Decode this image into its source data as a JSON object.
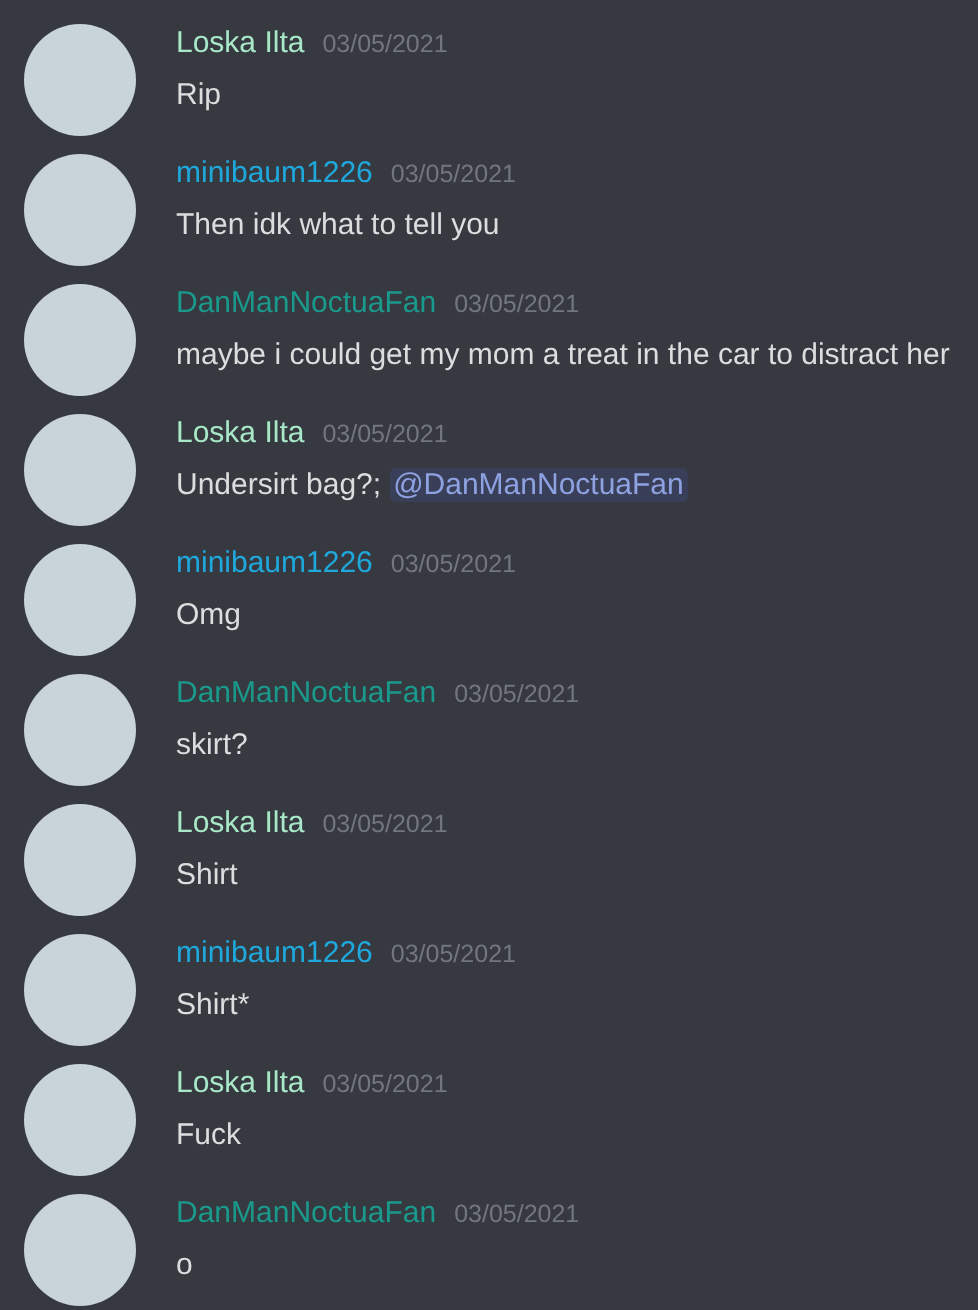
{
  "messages": [
    {
      "author": "Loska Ilta",
      "color": "#a8e8c8",
      "date": "03/05/2021",
      "text": "Rip"
    },
    {
      "author": "minibaum1226",
      "color": "#1fa8dc",
      "date": "03/05/2021",
      "text": "Then idk what to tell you"
    },
    {
      "author": "DanManNoctuaFan",
      "color": "#1a9a8c",
      "date": "03/05/2021",
      "text": "maybe i could get my mom a treat in the car to distract her"
    },
    {
      "author": "Loska Ilta",
      "color": "#a8e8c8",
      "date": "03/05/2021",
      "text": "Undersirt bag?;",
      "mention": "@DanManNoctuaFan"
    },
    {
      "author": "minibaum1226",
      "color": "#1fa8dc",
      "date": "03/05/2021",
      "text": "Omg"
    },
    {
      "author": "DanManNoctuaFan",
      "color": "#1a9a8c",
      "date": "03/05/2021",
      "text": "skirt?"
    },
    {
      "author": "Loska Ilta",
      "color": "#a8e8c8",
      "date": "03/05/2021",
      "text": "Shirt"
    },
    {
      "author": "minibaum1226",
      "color": "#1fa8dc",
      "date": "03/05/2021",
      "text": "Shirt*"
    },
    {
      "author": "Loska Ilta",
      "color": "#a8e8c8",
      "date": "03/05/2021",
      "text": "Fuck"
    },
    {
      "author": "DanManNoctuaFan",
      "color": "#1a9a8c",
      "date": "03/05/2021",
      "text": "o"
    }
  ]
}
